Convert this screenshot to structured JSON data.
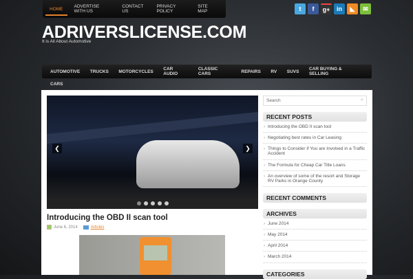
{
  "top_nav": [
    {
      "label": "HOME",
      "active": true
    },
    {
      "label": "ADVERTISE WITH US"
    },
    {
      "label": "CONTACT US"
    },
    {
      "label": "PRIVACY POLICY"
    },
    {
      "label": "SITE MAP"
    }
  ],
  "social": [
    {
      "icon": "twitter-icon",
      "glyph": "t",
      "color": "#4aa8e0"
    },
    {
      "icon": "facebook-icon",
      "glyph": "f",
      "color": "#3b5998"
    },
    {
      "icon": "google-plus-icon",
      "glyph": "g+",
      "color": "#333333"
    },
    {
      "icon": "linkedin-icon",
      "glyph": "in",
      "color": "#1a7bb9"
    },
    {
      "icon": "rss-icon",
      "glyph": "◣",
      "color": "#f08a24"
    },
    {
      "icon": "email-icon",
      "glyph": "✉",
      "color": "#7cbf3a"
    }
  ],
  "site": {
    "title": "ADRIVERSLICENSE.COM",
    "tagline": "It is All About Automotive"
  },
  "main_nav": [
    "AUTOMOTIVE",
    "TRUCKS",
    "MOTORCYCLES",
    "CAR AUDIO",
    "CLASSIC CARS",
    "REPAIRS",
    "RV",
    "SUVS",
    "CAR BUYING & SELLING",
    "CARS"
  ],
  "slider": {
    "prev": "❮",
    "next": "❯",
    "slides": 5,
    "active": 0
  },
  "post": {
    "title": "Introducing the OBD II scan tool",
    "date": "June 6, 2014",
    "category": "Articles"
  },
  "sidebar": {
    "search_placeholder": "Search",
    "search_icon": "⌕",
    "recent_posts_title": "RECENT POSTS",
    "recent_posts": [
      "Introducing the OBD II scan tool",
      "Negotiating best rates in Car Leasing",
      "Things to Consider if You are Involved in a Traffic Accident",
      "The Formula for Cheap Car Title Loans",
      "An overview of some of the resort and Storage RV Parks in Orange County"
    ],
    "recent_comments_title": "RECENT COMMENTS",
    "archives_title": "ARCHIVES",
    "archives": [
      "June 2014",
      "May 2014",
      "April 2014",
      "March 2014"
    ],
    "categories_title": "CATEGORIES"
  }
}
